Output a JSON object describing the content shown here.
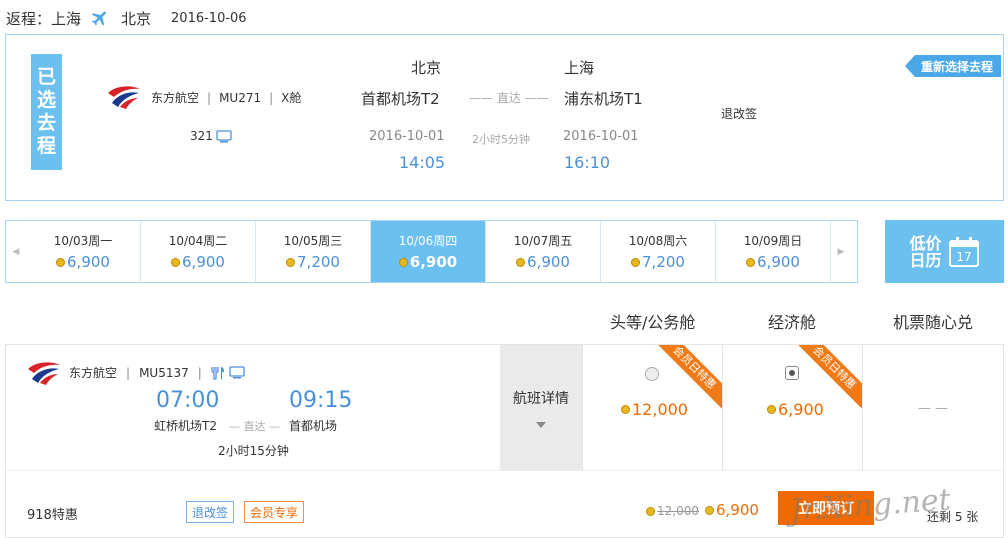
{
  "header": {
    "label": "返程：上海",
    "dest": "北京",
    "date": "2016-10-06"
  },
  "selected": {
    "tag_chars": [
      "已",
      "选",
      "去",
      "程"
    ],
    "airline": "东方航空",
    "flight_no": "MU271",
    "cabin": "X舱",
    "plane": "321",
    "dep_city": "北京",
    "dep_airport": "首都机场T2",
    "dep_date": "2016-10-01",
    "dep_time": "14:05",
    "direct": "—— 直达 ——",
    "duration": "2小时5分钟",
    "arr_city": "上海",
    "arr_airport": "浦东机场T1",
    "arr_date": "2016-10-01",
    "arr_time": "16:10",
    "refund": "退改签",
    "reselect": "重新选择去程"
  },
  "dates": [
    {
      "label": "10/03周一",
      "price": "6,900"
    },
    {
      "label": "10/04周二",
      "price": "6,900"
    },
    {
      "label": "10/05周三",
      "price": "7,200"
    },
    {
      "label": "10/06周四",
      "price": "6,900"
    },
    {
      "label": "10/07周五",
      "price": "6,900"
    },
    {
      "label": "10/08周六",
      "price": "7,200"
    },
    {
      "label": "10/09周日",
      "price": "6,900"
    }
  ],
  "calendar": {
    "line1": "低价",
    "line2": "日历",
    "day": "17"
  },
  "columns": {
    "first": "头等/公务舱",
    "economy": "经济舱",
    "flex": "机票随心兑"
  },
  "flight": {
    "airline": "东方航空",
    "flight_no": "MU5137",
    "dep_time": "07:00",
    "dep_airport": "虹桥机场T2",
    "direct": "— 直达 —",
    "arr_time": "09:15",
    "arr_airport": "首都机场",
    "duration": "2小时15分钟",
    "detail": "航班详情",
    "first_price": "12,000",
    "economy_price": "6,900",
    "ribbon": "会员日特惠",
    "flex_value": "— —"
  },
  "offer": {
    "name": "918特惠",
    "tag1": "退改签",
    "tag2": "会员专享",
    "old_price": "12,000",
    "new_price": "6,900",
    "book": "立即预订",
    "remain": "还剩 5 张"
  },
  "watermark": "Jr.Xing.net",
  "colors": {
    "accent": "#6cc0f0",
    "price": "#f06a00",
    "link": "#4a90d9"
  }
}
